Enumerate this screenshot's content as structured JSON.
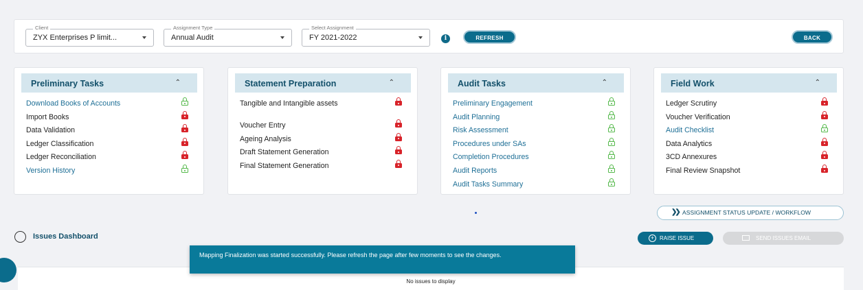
{
  "filters": {
    "client": {
      "label": "Client",
      "value": "ZYX Enterprises P limit..."
    },
    "assignment_type": {
      "label": "Assignment Type",
      "value": "Annual Audit"
    },
    "select_assignment": {
      "label": "Select Assignment",
      "value": "FY 2021-2022"
    },
    "refresh_label": "REFRESH",
    "back_label": "BACK",
    "info_icon": "i"
  },
  "cards": [
    {
      "title": "Preliminary Tasks",
      "tasks": [
        {
          "label": "Download Books of Accounts",
          "link": true,
          "lock": "unlocked"
        },
        {
          "label": "Import Books",
          "link": false,
          "lock": "locked"
        },
        {
          "label": "Data Validation",
          "link": false,
          "lock": "locked"
        },
        {
          "label": "Ledger Classification",
          "link": false,
          "lock": "locked"
        },
        {
          "label": "Ledger Reconciliation",
          "link": false,
          "lock": "locked"
        },
        {
          "label": "Version History",
          "link": true,
          "lock": "unlocked"
        }
      ]
    },
    {
      "title": "Statement Preparation",
      "tasks": [
        {
          "label": "Tangible and Intangible assets",
          "link": false,
          "lock": "locked"
        },
        {
          "label": "Voucher Entry",
          "link": false,
          "lock": "locked"
        },
        {
          "label": "Ageing Analysis",
          "link": false,
          "lock": "locked"
        },
        {
          "label": "Draft Statement Generation",
          "link": false,
          "lock": "locked"
        },
        {
          "label": "Final Statement Generation",
          "link": false,
          "lock": "locked"
        }
      ]
    },
    {
      "title": "Audit Tasks",
      "tasks": [
        {
          "label": "Preliminary Engagement",
          "link": true,
          "lock": "unlocked"
        },
        {
          "label": "Audit Planning",
          "link": true,
          "lock": "unlocked"
        },
        {
          "label": "Risk Assessment",
          "link": true,
          "lock": "unlocked"
        },
        {
          "label": "Procedures under SAs",
          "link": true,
          "lock": "unlocked"
        },
        {
          "label": "Completion Procedures",
          "link": true,
          "lock": "unlocked"
        },
        {
          "label": "Audit Reports",
          "link": true,
          "lock": "unlocked"
        },
        {
          "label": "Audit Tasks Summary",
          "link": true,
          "lock": "unlocked"
        }
      ]
    },
    {
      "title": "Field Work",
      "tasks": [
        {
          "label": "Ledger Scrutiny",
          "link": false,
          "lock": "locked"
        },
        {
          "label": "Voucher Verification",
          "link": false,
          "lock": "locked"
        },
        {
          "label": "Audit Checklist",
          "link": true,
          "lock": "unlocked"
        },
        {
          "label": "Data Analytics",
          "link": false,
          "lock": "locked"
        },
        {
          "label": "3CD Annexures",
          "link": false,
          "lock": "locked"
        },
        {
          "label": "Final Review Snapshot",
          "link": false,
          "lock": "locked"
        }
      ]
    }
  ],
  "workflow_button": "ASSIGNMENT STATUS UPDATE / WORKFLOW",
  "issues": {
    "title": "Issues Dashboard",
    "raise_label": "RAISE ISSUE",
    "send_email_label": "SEND ISSUES EMAIL",
    "empty_message": "No issues to display"
  },
  "toast": {
    "message": "Mapping Finalization was started successfully. Please refresh the page after few moments to see the changes."
  },
  "colors": {
    "primary": "#0b6c8c",
    "card_header": "#d5e6ee",
    "link": "#1e6f96",
    "locked": "#d8232a",
    "unlocked": "#52b848",
    "toast": "#097a9a"
  }
}
